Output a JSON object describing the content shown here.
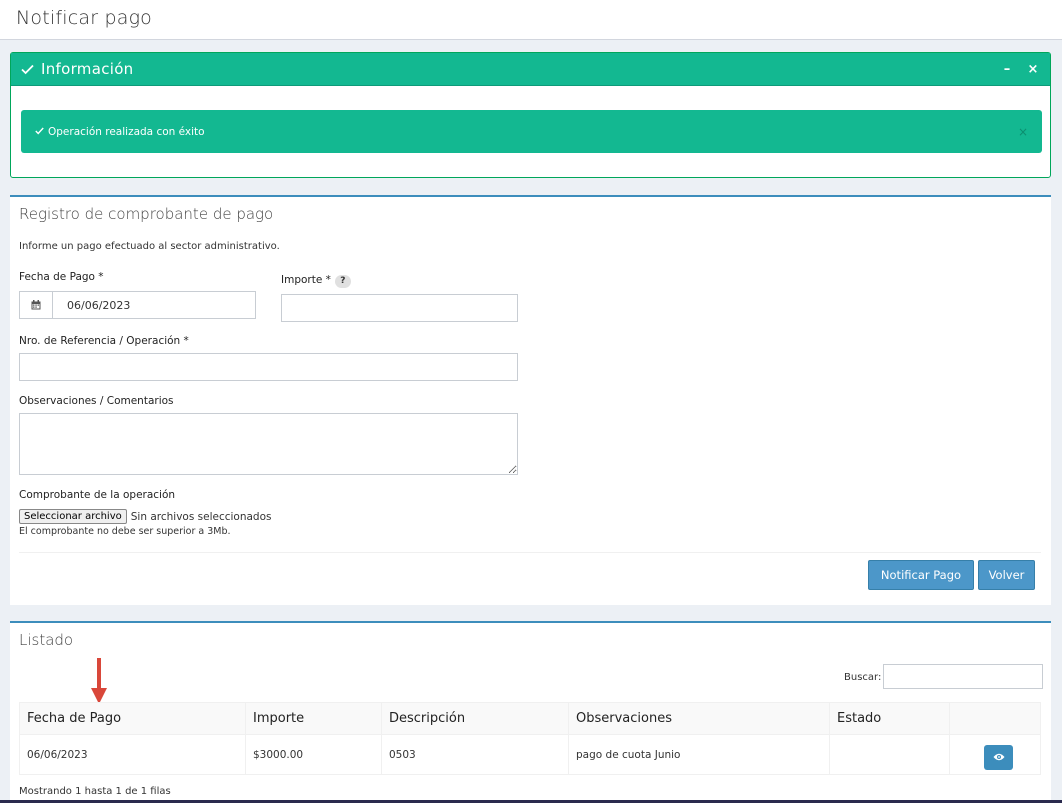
{
  "page": {
    "title": "Notificar pago"
  },
  "info": {
    "title": "Información",
    "minimize": "–",
    "close": "×",
    "alert_text": "Operación realizada con éxito",
    "alert_close": "×"
  },
  "registro": {
    "title": "Registro de comprobante de pago",
    "help": "Informe un pago efectuado al sector administrativo.",
    "fecha_label": "Fecha de Pago *",
    "fecha_value": "06/06/2023",
    "importe_label": "Importe *",
    "importe_help": "?",
    "referencia_label": "Nro. de Referencia / Operación *",
    "observaciones_label": "Observaciones / Comentarios",
    "comprobante_label": "Comprobante de la operación",
    "file_button": "Seleccionar archivo",
    "file_status": "Sin archivos seleccionados",
    "file_note": "El comprobante no debe ser superior a 3Mb.",
    "submit_label": "Notificar Pago",
    "back_label": "Volver"
  },
  "listado": {
    "title": "Listado",
    "search_label": "Buscar:",
    "columns": [
      "Fecha de Pago",
      "Importe",
      "Descripción",
      "Observaciones",
      "Estado",
      ""
    ],
    "rows": [
      {
        "fecha": "06/06/2023",
        "importe": "$3000.00",
        "descripcion": "0503",
        "observaciones": "pago de cuota Junio",
        "estado": ""
      }
    ],
    "footer": "Mostrando 1 hasta 1 de 1 filas"
  },
  "colors": {
    "success": "#13b891",
    "primary": "#3c8dbc",
    "arrow": "#d9473a"
  },
  "icons": [
    "check-icon",
    "calendar-icon",
    "eye-icon",
    "arrow-down-icon"
  ]
}
